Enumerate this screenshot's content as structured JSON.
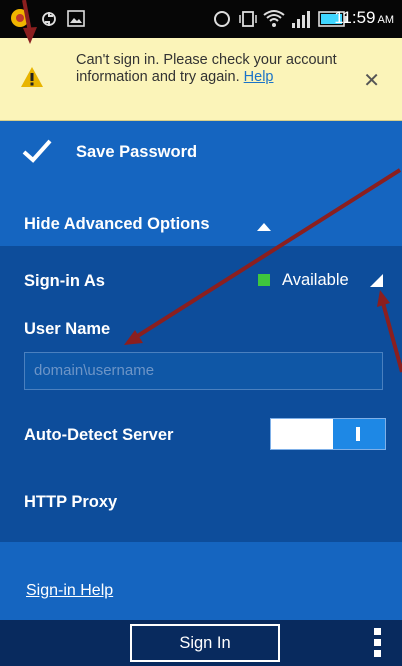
{
  "status_bar": {
    "time": "11:59",
    "ampm": "AM",
    "icons": [
      "app-notification-icon",
      "sync-icon",
      "image-icon",
      "alarm-icon",
      "vibrate-icon",
      "wifi-icon",
      "signal-icon",
      "battery-icon"
    ]
  },
  "banner": {
    "message": "Can't sign in. Please check your account information and try again.",
    "link_label": "Help",
    "close_glyph": "✕",
    "icon": "warning-icon"
  },
  "options": {
    "save_password_label": "Save Password",
    "save_password_checked": true,
    "advanced_toggle_label": "Hide Advanced Options",
    "sign_in_as_label": "Sign-in As",
    "presence_value": "Available",
    "presence_color": "#3ec63e",
    "user_name_label": "User Name",
    "user_name_placeholder": "domain\\username",
    "user_name_value": "",
    "auto_detect_label": "Auto-Detect Server",
    "auto_detect_on": true,
    "http_proxy_label": "HTTP Proxy",
    "sign_in_help_label": "Sign-in Help"
  },
  "bottom_bar": {
    "sign_in_label": "Sign In",
    "menu_icon": "overflow-menu-icon"
  },
  "colors": {
    "panel_light": "#1565c0",
    "panel_dark": "#0d4d9b",
    "bottom_bar": "#082a5e",
    "banner_bg": "#fbf4b9",
    "annotation_arrow": "#8b1f1f"
  }
}
